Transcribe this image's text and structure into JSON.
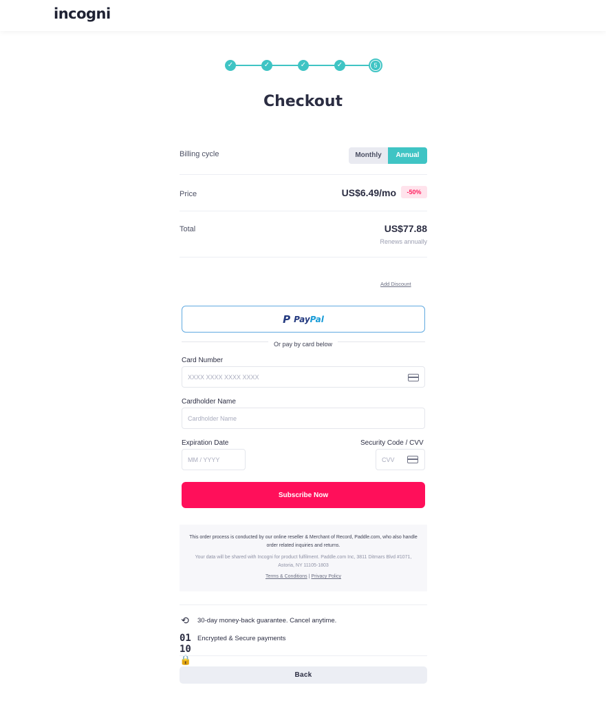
{
  "brand": {
    "logo_text": "incogni"
  },
  "stepper": {
    "current_step": 5,
    "total_steps": 5,
    "check_glyph": "✓",
    "current_label": "5"
  },
  "page": {
    "title": "Checkout"
  },
  "summary": {
    "billing_label": "Billing cycle",
    "billing_options": [
      "Monthly",
      "Annual"
    ],
    "billing_selected": "Annual",
    "price_label": "Price",
    "price_value": "US$6.49/mo",
    "discount_badge": "-50%",
    "total_label": "Total",
    "total_value": "US$77.88",
    "renews_text": "Renews annually"
  },
  "discount": {
    "link_label": "Add Discount"
  },
  "paypal": {
    "pay": "Pay",
    "pal": "Pal"
  },
  "divider_text": "Or pay by card below",
  "form": {
    "card_number_label": "Card Number",
    "card_number_placeholder": "XXXX XXXX XXXX XXXX",
    "cardholder_label": "Cardholder Name",
    "cardholder_placeholder": "Cardholder Name",
    "expiration_label": "Expiration Date",
    "expiration_placeholder": "MM / YYYY",
    "cvv_label": "Security Code / CVV",
    "cvv_placeholder": "CVV",
    "submit_label": "Subscribe Now"
  },
  "legal": {
    "line1": "This order process is conducted by our online reseller & Merchant of Record, Paddle.com, who also handle order related inquiries and returns.",
    "line2": "Your data will be shared with Incogni for product fulfilment. Paddle.com Inc, 3811 Ditmars Blvd #1071, Astoria, NY 11105-1803",
    "terms_label": "Terms & Conditions",
    "separator": "|",
    "privacy_label": "Privacy Policy"
  },
  "features": [
    {
      "icon": "refresh-icon",
      "text": "30-day money-back guarantee. Cancel anytime."
    },
    {
      "icon": "encrypted-lock-icon",
      "text": "Encrypted & Secure payments"
    }
  ],
  "back_label": "Back",
  "colors": {
    "accent": "#3fc4c4",
    "cta": "#ff0f5a",
    "badge_bg": "#ffe3ec",
    "badge_text": "#ff1f5e"
  }
}
